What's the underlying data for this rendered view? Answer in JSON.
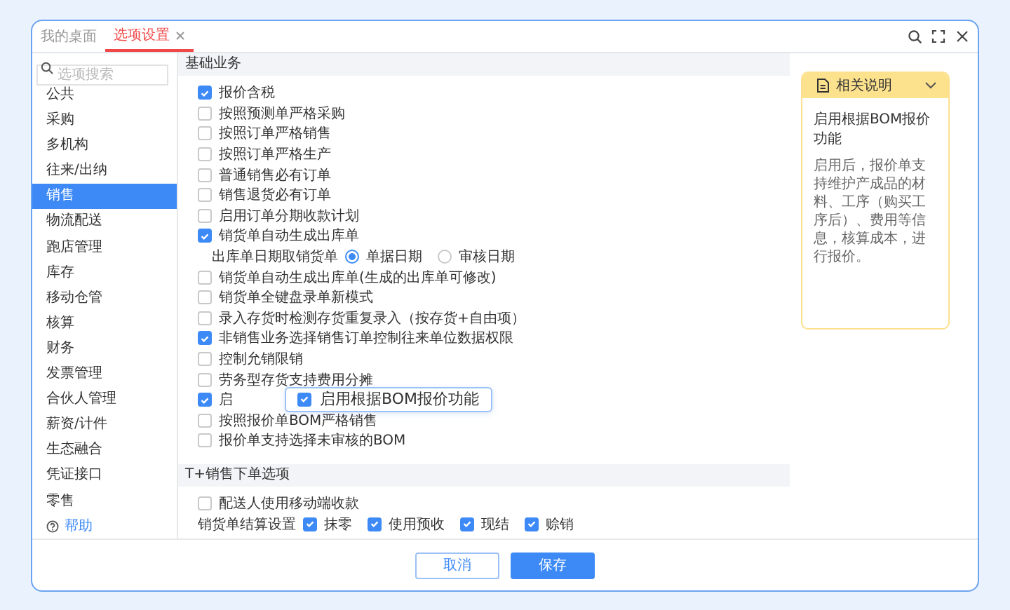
{
  "tabs": [
    {
      "label": "我的桌面",
      "selected": false,
      "closable": false
    },
    {
      "label": "选项设置",
      "selected": true,
      "closable": true
    }
  ],
  "sidebar": {
    "search": {
      "placeholder": "选项搜索"
    },
    "items": [
      {
        "label": "公共",
        "selected": false
      },
      {
        "label": "采购",
        "selected": false
      },
      {
        "label": "多机构",
        "selected": false
      },
      {
        "label": "往来/出纳",
        "selected": false
      },
      {
        "label": "销售",
        "selected": true
      },
      {
        "label": "物流配送",
        "selected": false
      },
      {
        "label": "跑店管理",
        "selected": false
      },
      {
        "label": "库存",
        "selected": false
      },
      {
        "label": "移动仓管",
        "selected": false
      },
      {
        "label": "核算",
        "selected": false
      },
      {
        "label": "财务",
        "selected": false
      },
      {
        "label": "发票管理",
        "selected": false
      },
      {
        "label": "合伙人管理",
        "selected": false
      },
      {
        "label": "薪资/计件",
        "selected": false
      },
      {
        "label": "生态融合",
        "selected": false
      },
      {
        "label": "凭证接口",
        "selected": false
      },
      {
        "label": "零售",
        "selected": false
      }
    ],
    "help": "帮助"
  },
  "sections": [
    {
      "title": "基础业务",
      "rows": [
        {
          "kind": "checkbox",
          "label": "报价含税",
          "checked": true
        },
        {
          "kind": "checkbox",
          "label": "按照预测单严格采购",
          "checked": false
        },
        {
          "kind": "checkbox",
          "label": "按照订单严格销售",
          "checked": false
        },
        {
          "kind": "checkbox",
          "label": "按照订单严格生产",
          "checked": false
        },
        {
          "kind": "checkbox",
          "label": "普通销售必有订单",
          "checked": false
        },
        {
          "kind": "checkbox",
          "label": "销售退货必有订单",
          "checked": false
        },
        {
          "kind": "checkbox",
          "label": "启用订单分期收款计划",
          "checked": false
        },
        {
          "kind": "checkbox",
          "label": "销货单自动生成出库单",
          "checked": true
        },
        {
          "kind": "radio",
          "label": "出库单日期取销货单",
          "options": [
            {
              "label": "单据日期",
              "selected": true
            },
            {
              "label": "审核日期",
              "selected": false
            }
          ]
        },
        {
          "kind": "checkbox",
          "label": "销货单自动生成出库单(生成的出库单可修改)",
          "checked": false
        },
        {
          "kind": "checkbox",
          "label": "销货单全键盘录单新模式",
          "checked": false
        },
        {
          "kind": "checkbox",
          "label": "录入存货时检测存货重复录入（按存货+自由项）",
          "checked": false
        },
        {
          "kind": "checkbox",
          "label": "非销售业务选择销售订单控制往来单位数据权限",
          "checked": true
        },
        {
          "kind": "checkbox",
          "label": "控制允销限销",
          "checked": false
        },
        {
          "kind": "checkbox",
          "label": "劳务型存货支持费用分摊",
          "checked": false
        },
        {
          "kind": "checkbox",
          "label": "启",
          "checked": true,
          "popup": {
            "label": "启用根据BOM报价功能",
            "checked": true
          }
        },
        {
          "kind": "checkbox",
          "label": "按照报价单BOM严格销售",
          "checked": false
        },
        {
          "kind": "checkbox",
          "label": "报价单支持选择未审核的BOM",
          "checked": false
        }
      ]
    },
    {
      "title": "T+销售下单选项",
      "rows": [
        {
          "kind": "checkbox",
          "label": "配送人使用移动端收款",
          "checked": false
        },
        {
          "kind": "checks",
          "label": "销货单结算设置",
          "options": [
            {
              "label": "抹零",
              "checked": true
            },
            {
              "label": "使用预收",
              "checked": true
            },
            {
              "label": "现结",
              "checked": true
            },
            {
              "label": "赊销",
              "checked": true
            }
          ]
        }
      ]
    }
  ],
  "help_panel": {
    "title": "相关说明",
    "expanded": true,
    "heading": "启用根据BOM报价功能",
    "body": "启用后，报价单支持维护产成品的材料、工序（购买工序后）、费用等信息，核算成本，进行报价。"
  },
  "buttons": [
    {
      "label": "取消",
      "kind": "secondary"
    },
    {
      "label": "保存",
      "kind": "primary"
    }
  ]
}
